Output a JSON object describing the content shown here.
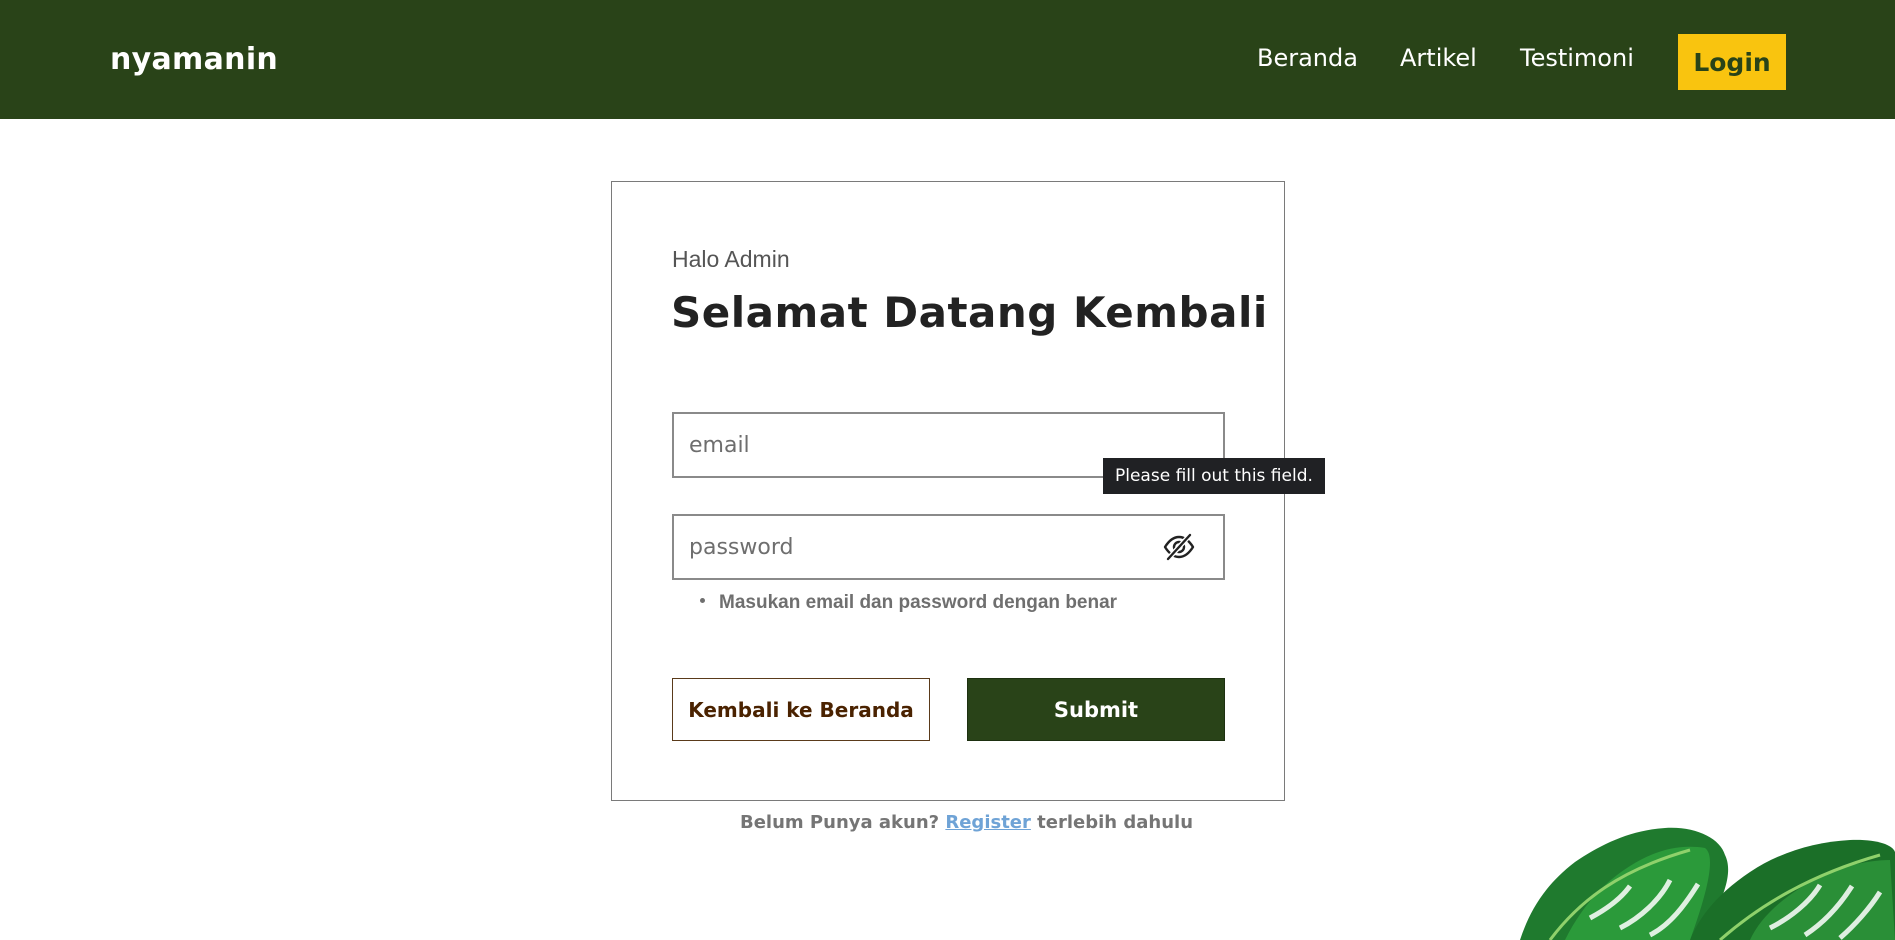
{
  "header": {
    "brand": "nyamanin",
    "nav": {
      "beranda": "Beranda",
      "artikel": "Artikel",
      "testimoni": "Testimoni",
      "login": "Login"
    }
  },
  "login_form": {
    "greeting": "Halo Admin",
    "title": "Selamat Datang Kembali",
    "email": {
      "placeholder": "email",
      "value": ""
    },
    "password": {
      "placeholder": "password",
      "value": ""
    },
    "tooltip": "Please fill out this field.",
    "errors": [
      "Masukan email dan password dengan benar"
    ],
    "back_label": "Kembali ke Beranda",
    "submit_label": "Submit"
  },
  "register_prompt": {
    "before": "Belum Punya akun? ",
    "link": "Register",
    "after": " terlebih dahulu"
  },
  "icons": {
    "password_toggle": "eye-slash-icon",
    "decoration": "monstera-leaf-illustration"
  },
  "colors": {
    "primary_green": "#294318",
    "accent_yellow": "#f9c40f",
    "link_blue": "#6fa3d6",
    "tooltip_bg": "#202124"
  }
}
